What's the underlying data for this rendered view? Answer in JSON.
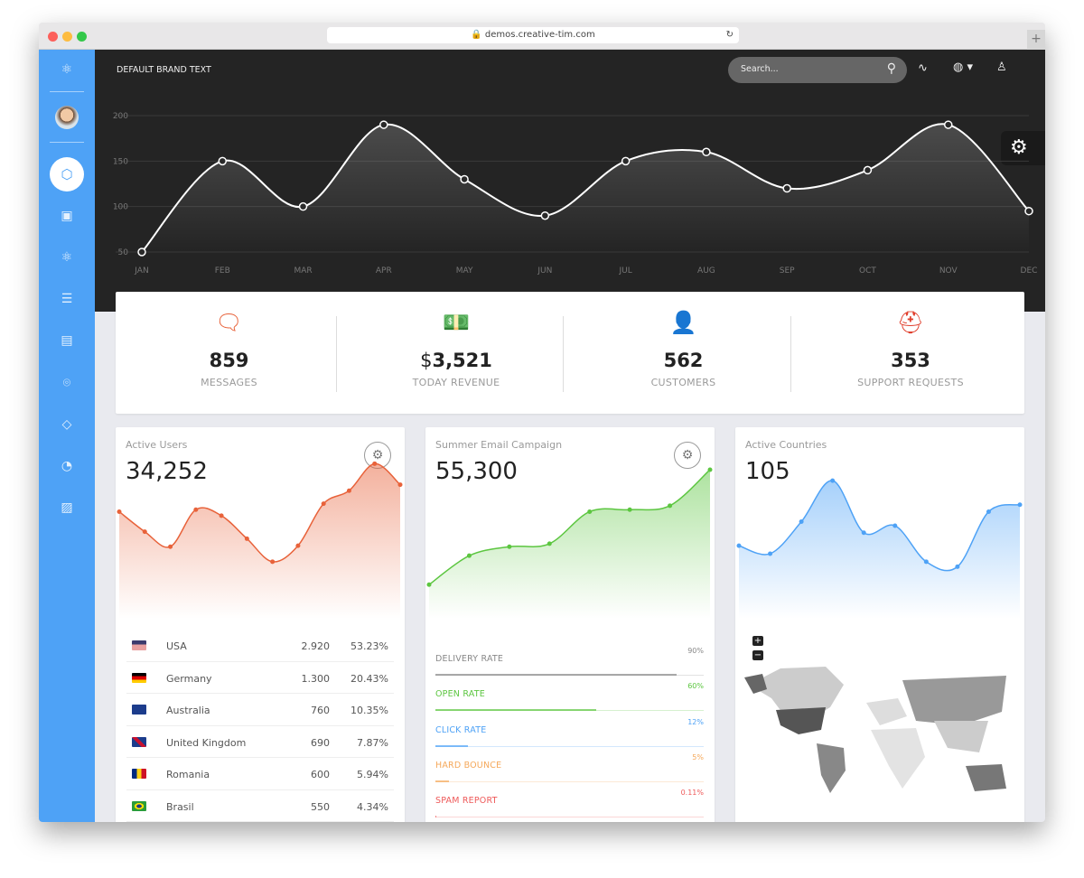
{
  "browser": {
    "url": "demos.creative-tim.com",
    "new_tab": "+"
  },
  "header": {
    "brand": "DEFAULT BRAND TEXT",
    "search_placeholder": "Search..."
  },
  "sidebar": {
    "items": [
      "dashboard",
      "image",
      "atom",
      "list",
      "document",
      "map-pin",
      "diamond",
      "pie-chart",
      "gallery"
    ],
    "active": "dashboard"
  },
  "chart_data": [
    {
      "type": "line",
      "categories": [
        "JAN",
        "FEB",
        "MAR",
        "APR",
        "MAY",
        "JUN",
        "JUL",
        "AUG",
        "SEP",
        "OCT",
        "NOV",
        "DEC"
      ],
      "values": [
        50,
        150,
        100,
        190,
        130,
        90,
        150,
        160,
        120,
        140,
        190,
        95
      ],
      "yticks": [
        "200",
        "150",
        "100",
        "50"
      ],
      "ylim": [
        50,
        200
      ],
      "grid": true,
      "color": "#ffffff"
    },
    {
      "type": "area",
      "values": [
        89,
        69,
        54,
        91,
        85,
        62,
        39,
        55,
        97,
        110,
        137,
        116
      ],
      "color": "#e8623a"
    },
    {
      "type": "area",
      "values": [
        16,
        45,
        54,
        57,
        89,
        91,
        95,
        131
      ],
      "color": "#5cc640"
    },
    {
      "type": "area",
      "values": [
        55,
        47,
        79,
        120,
        68,
        75,
        39,
        34,
        89,
        96
      ],
      "color": "#4ea2f6"
    }
  ],
  "stats": [
    {
      "icon": "chat-bubble-icon",
      "value": "859",
      "label": "MESSAGES",
      "color": "#e8623a"
    },
    {
      "prefix": "$",
      "icon": "money-icon",
      "value": "3,521",
      "label": "TODAY REVENUE",
      "color": "#5cc640"
    },
    {
      "icon": "user-icon",
      "value": "562",
      "label": "CUSTOMERS",
      "color": "#4ea2f6"
    },
    {
      "icon": "lifebuoy-icon",
      "value": "353",
      "label": "SUPPORT REQUESTS",
      "color": "#e0402e"
    }
  ],
  "active_users": {
    "title": "Active Users",
    "value": "34,252",
    "rows": [
      {
        "country": "USA",
        "count": "2.920",
        "pct": "53.23%"
      },
      {
        "country": "Germany",
        "count": "1.300",
        "pct": "20.43%"
      },
      {
        "country": "Australia",
        "count": "760",
        "pct": "10.35%"
      },
      {
        "country": "United Kingdom",
        "count": "690",
        "pct": "7.87%"
      },
      {
        "country": "Romania",
        "count": "600",
        "pct": "5.94%"
      },
      {
        "country": "Brasil",
        "count": "550",
        "pct": "4.34%"
      }
    ]
  },
  "email": {
    "title": "Summer Email Campaign",
    "value": "55,300",
    "bars": [
      {
        "label": "DELIVERY RATE",
        "value": "90%",
        "fraction": 0.9,
        "color": "#888888"
      },
      {
        "label": "OPEN RATE",
        "value": "60%",
        "fraction": 0.6,
        "color": "#5cc640"
      },
      {
        "label": "CLICK RATE",
        "value": "12%",
        "fraction": 0.12,
        "color": "#4ea2f6"
      },
      {
        "label": "HARD BOUNCE",
        "value": "5%",
        "fraction": 0.05,
        "color": "#f5a85a"
      },
      {
        "label": "SPAM REPORT",
        "value": "0.11%",
        "fraction": 0.0011,
        "color": "#ee5a5a"
      }
    ]
  },
  "countries": {
    "title": "Active Countries",
    "value": "105",
    "zoom_in": "+",
    "zoom_out": "−"
  }
}
